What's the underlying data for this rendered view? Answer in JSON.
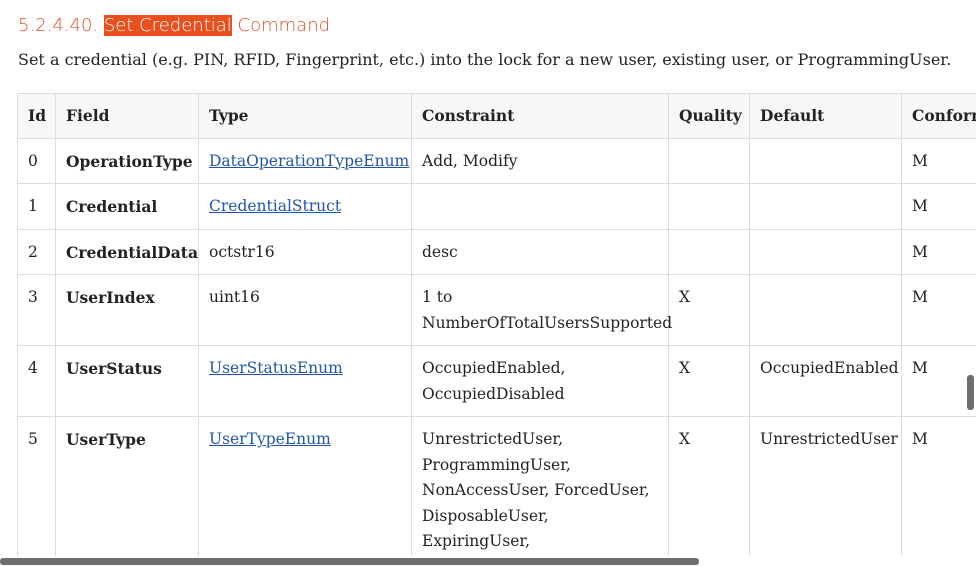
{
  "section": {
    "number": "5.2.4.40. ",
    "highlight": "Set Credential",
    "rest": " Command",
    "description": "Set a credential (e.g. PIN, RFID, Fingerprint, etc.) into the lock for a new user, existing user, or ProgrammingUser."
  },
  "table": {
    "headers": [
      "Id",
      "Field",
      "Type",
      "Constraint",
      "Quality",
      "Default",
      "Conformance"
    ],
    "rows": [
      {
        "id": "0",
        "field": "OperationType",
        "type": "DataOperationTypeEnum",
        "type_is_link": true,
        "constraint": "Add, Modify",
        "quality": "",
        "default": "",
        "conformance": "M"
      },
      {
        "id": "1",
        "field": "Credential",
        "type": "CredentialStruct",
        "type_is_link": true,
        "constraint": "",
        "quality": "",
        "default": "",
        "conformance": "M"
      },
      {
        "id": "2",
        "field": "CredentialData",
        "type": "octstr16",
        "type_is_link": false,
        "constraint": "desc",
        "quality": "",
        "default": "",
        "conformance": "M"
      },
      {
        "id": "3",
        "field": "UserIndex",
        "type": "uint16",
        "type_is_link": false,
        "constraint": "1 to NumberOfTotalUsersSupported",
        "quality": "X",
        "default": "",
        "conformance": "M"
      },
      {
        "id": "4",
        "field": "UserStatus",
        "type": "UserStatusEnum",
        "type_is_link": true,
        "constraint": "OccupiedEnabled, OccupiedDisabled",
        "quality": "X",
        "default": "OccupiedEnabled",
        "conformance": "M"
      },
      {
        "id": "5",
        "field": "UserType",
        "type": "UserTypeEnum",
        "type_is_link": true,
        "constraint": "UnrestrictedUser, ProgrammingUser, NonAccessUser, ForcedUser, DisposableUser, ExpiringUser, RemoteOnlyUser",
        "quality": "X",
        "default": "UnrestrictedUser",
        "conformance": "M"
      }
    ]
  },
  "colors": {
    "heading": "#d9542c",
    "highlight": "#e8501e",
    "link": "#2156a5"
  }
}
